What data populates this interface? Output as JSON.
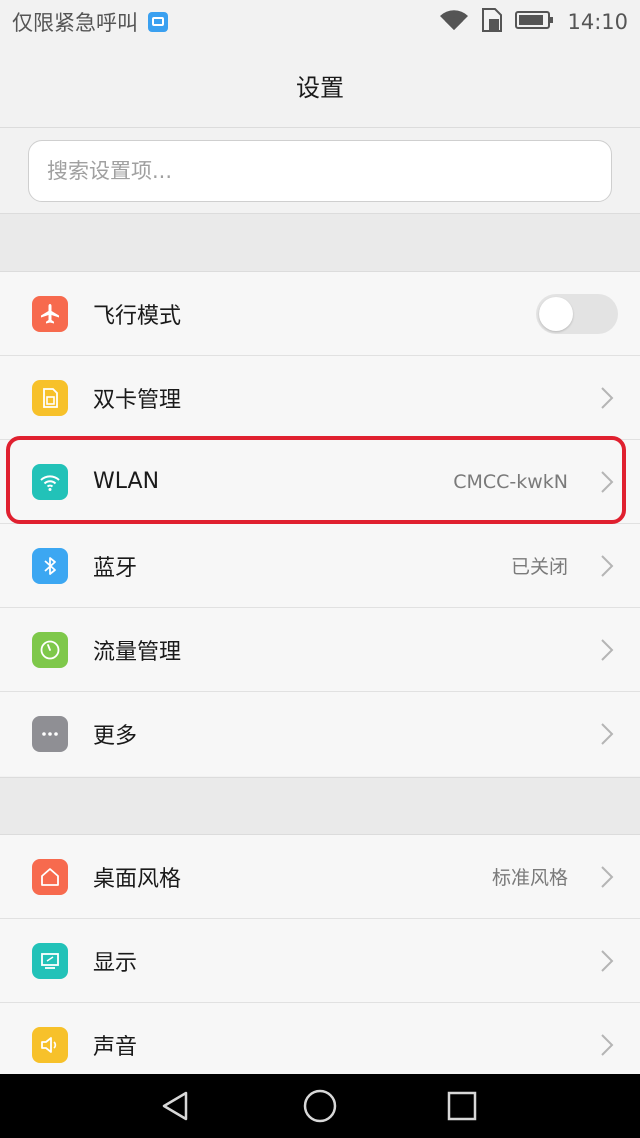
{
  "status_bar": {
    "carrier_text": "仅限紧急呼叫",
    "time": "14:10",
    "icons": [
      "image-notification-icon",
      "wifi-icon",
      "sim-card-icon",
      "battery-icon"
    ]
  },
  "header": {
    "title": "设置"
  },
  "search": {
    "placeholder": "搜索设置项..."
  },
  "section1": {
    "items": [
      {
        "label": "飞行模式",
        "value": "",
        "icon": "airplane-icon",
        "color": "#f76a4e",
        "control": "toggle",
        "toggle_on": false
      },
      {
        "label": "双卡管理",
        "value": "",
        "icon": "sim-card-icon",
        "color": "#f7c12a",
        "control": "chevron"
      },
      {
        "label": "WLAN",
        "value": "CMCC-kwkN",
        "icon": "wifi-icon",
        "color": "#22c2b8",
        "control": "chevron",
        "highlighted": true
      },
      {
        "label": "蓝牙",
        "value": "已关闭",
        "icon": "bluetooth-icon",
        "color": "#3ca7f2",
        "control": "chevron"
      },
      {
        "label": "流量管理",
        "value": "",
        "icon": "data-usage-icon",
        "color": "#7ec84a",
        "control": "chevron"
      },
      {
        "label": "更多",
        "value": "",
        "icon": "more-icon",
        "color": "#8f8f94",
        "control": "chevron"
      }
    ]
  },
  "section2": {
    "items": [
      {
        "label": "桌面风格",
        "value": "标准风格",
        "icon": "home-icon",
        "color": "#f76a4e",
        "control": "chevron"
      },
      {
        "label": "显示",
        "value": "",
        "icon": "display-icon",
        "color": "#22c2b8",
        "control": "chevron"
      },
      {
        "label": "声音",
        "value": "",
        "icon": "sound-icon",
        "color": "#f7c12a",
        "control": "chevron"
      }
    ]
  },
  "highlight_color": "#e0202f",
  "nav_bar": {
    "buttons": [
      "back-icon",
      "home-circle-icon",
      "recents-icon"
    ]
  }
}
